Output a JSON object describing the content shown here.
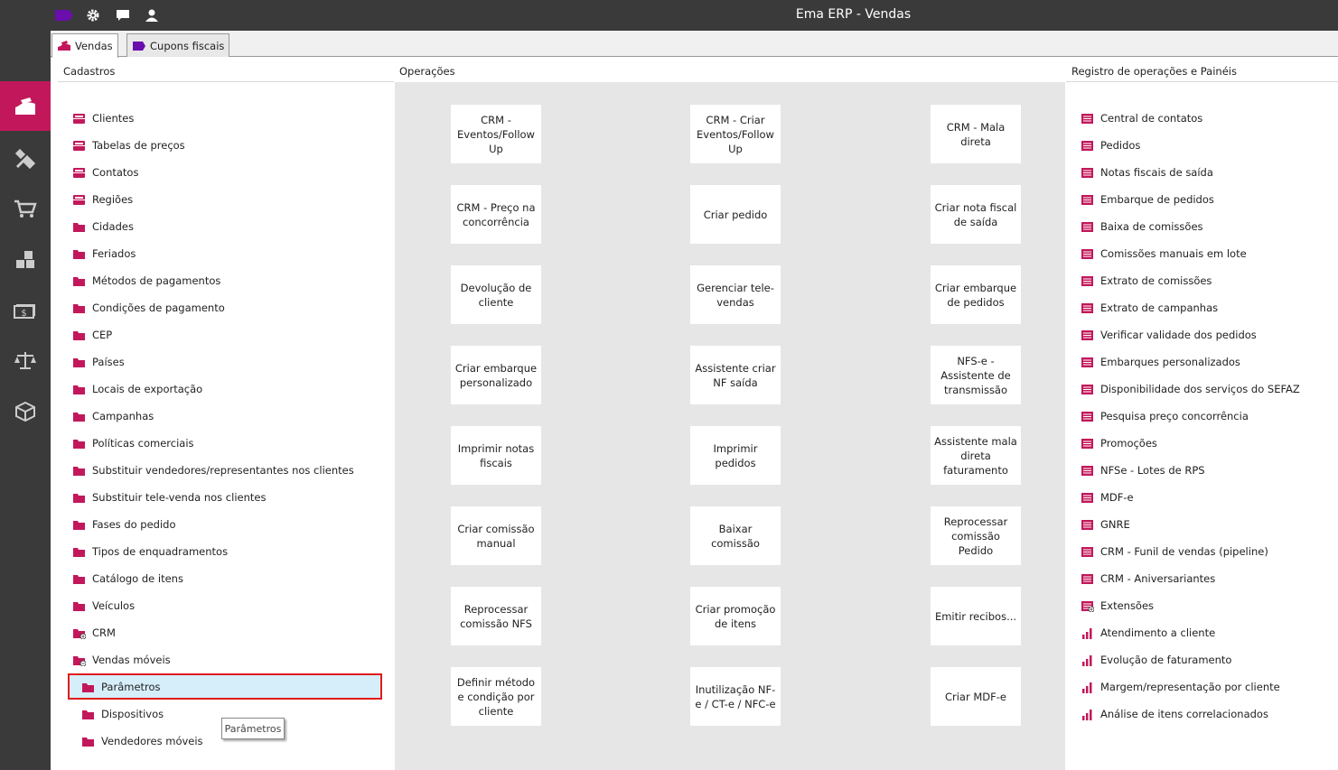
{
  "window": {
    "title": "Ema ERP - Vendas"
  },
  "colors": {
    "accent": "#c2185b",
    "topbar": "#3a3a3a",
    "purple": "#6a0dad",
    "highlight": "#e01b1b"
  },
  "topbar_icons": [
    "tag-icon",
    "gear-icon",
    "chat-icon",
    "user-icon"
  ],
  "sidebar": {
    "items": [
      "sales-icon",
      "tools-icon",
      "cart-icon",
      "stock-icon",
      "money-icon",
      "scale-icon",
      "box-icon"
    ],
    "active_index": 0
  },
  "tabs": [
    {
      "label": "Vendas"
    },
    {
      "label": "Cupons fiscais"
    }
  ],
  "columns": {
    "cadastros": "Cadastros",
    "operacoes": "Operações",
    "registro": "Registro de operações e Painéis"
  },
  "cadastros": [
    {
      "label": "Clientes",
      "icon": "drawer-icon"
    },
    {
      "label": "Tabelas de preços",
      "icon": "drawer-icon"
    },
    {
      "label": "Contatos",
      "icon": "drawer-icon"
    },
    {
      "label": "Regiões",
      "icon": "drawer-icon"
    },
    {
      "label": "Cidades",
      "icon": "folder-icon"
    },
    {
      "label": "Feriados",
      "icon": "folder-icon"
    },
    {
      "label": "Métodos de pagamentos",
      "icon": "folder-icon"
    },
    {
      "label": "Condições de pagamento",
      "icon": "folder-icon"
    },
    {
      "label": "CEP",
      "icon": "folder-icon"
    },
    {
      "label": "Países",
      "icon": "folder-icon"
    },
    {
      "label": "Locais de exportação",
      "icon": "folder-icon"
    },
    {
      "label": "Campanhas",
      "icon": "folder-icon"
    },
    {
      "label": "Políticas comerciais",
      "icon": "folder-icon"
    },
    {
      "label": "Substituir vendedores/representantes nos clientes",
      "icon": "folder-icon"
    },
    {
      "label": "Substituir tele-venda nos clientes",
      "icon": "folder-icon"
    },
    {
      "label": "Fases do pedido",
      "icon": "folder-icon"
    },
    {
      "label": "Tipos de enquadramentos",
      "icon": "folder-icon"
    },
    {
      "label": "Catálogo de itens",
      "icon": "folder-icon"
    },
    {
      "label": "Veículos",
      "icon": "folder-icon"
    },
    {
      "label": "CRM",
      "icon": "folder-expand-icon"
    },
    {
      "label": "Vendas móveis",
      "icon": "folder-collapse-icon"
    },
    {
      "label": "Parâmetros",
      "icon": "folder-icon",
      "sub": true,
      "selected": true
    },
    {
      "label": "Dispositivos",
      "icon": "folder-icon",
      "sub": true
    },
    {
      "label": "Vendedores móveis",
      "icon": "folder-icon",
      "sub": true
    }
  ],
  "operacoes": [
    [
      "CRM - Eventos/Follow Up",
      "CRM - Criar Eventos/Follow Up",
      "CRM - Mala direta"
    ],
    [
      "CRM - Preço na concorrência",
      "Criar pedido",
      "Criar nota fiscal de saída"
    ],
    [
      "Devolução de cliente",
      "Gerenciar tele-vendas",
      "Criar embarque de pedidos"
    ],
    [
      "Criar embarque personalizado",
      "Assistente criar NF saída",
      "NFS-e - Assistente de transmissão"
    ],
    [
      "Imprimir notas fiscais",
      "Imprimir pedidos",
      "Assistente mala direta faturamento"
    ],
    [
      "Criar comissão manual",
      "Baixar comissão",
      "Reprocessar comissão Pedido"
    ],
    [
      "Reprocessar comissão NFS",
      "Criar promoção de itens",
      "Emitir recibos..."
    ],
    [
      "Definir método e condição por cliente",
      "Inutilização NF-e / CT-e / NFC-e",
      "Criar MDF-e"
    ]
  ],
  "registro": [
    {
      "label": "Central de contatos",
      "icon": "list-icon"
    },
    {
      "label": "Pedidos",
      "icon": "list-icon"
    },
    {
      "label": "Notas fiscais de saída",
      "icon": "list-icon"
    },
    {
      "label": "Embarque de pedidos",
      "icon": "list-icon"
    },
    {
      "label": "Baixa de comissões",
      "icon": "list-icon"
    },
    {
      "label": "Comissões manuais em lote",
      "icon": "list-icon"
    },
    {
      "label": "Extrato de comissões",
      "icon": "list-icon"
    },
    {
      "label": "Extrato de campanhas",
      "icon": "list-icon"
    },
    {
      "label": "Verificar validade dos pedidos",
      "icon": "list-icon"
    },
    {
      "label": "Embarques personalizados",
      "icon": "list-icon"
    },
    {
      "label": "Disponibilidade dos serviços do SEFAZ",
      "icon": "list-icon"
    },
    {
      "label": "Pesquisa preço concorrência",
      "icon": "list-icon"
    },
    {
      "label": "Promoções",
      "icon": "list-icon"
    },
    {
      "label": "NFSe - Lotes de RPS",
      "icon": "list-icon"
    },
    {
      "label": "MDF-e",
      "icon": "list-icon"
    },
    {
      "label": "GNRE",
      "icon": "list-icon"
    },
    {
      "label": "CRM - Funil de vendas (pipeline)",
      "icon": "list-icon"
    },
    {
      "label": "CRM - Aniversariantes",
      "icon": "list-icon"
    },
    {
      "label": "Extensões",
      "icon": "list-expand-icon"
    },
    {
      "label": "Atendimento a cliente",
      "icon": "bar-chart-icon"
    },
    {
      "label": "Evolução de faturamento",
      "icon": "bar-chart-icon"
    },
    {
      "label": "Margem/representação por cliente",
      "icon": "bar-chart-icon"
    },
    {
      "label": "Análise de itens correlacionados",
      "icon": "bar-chart-icon"
    }
  ],
  "tooltip": "Parâmetros"
}
